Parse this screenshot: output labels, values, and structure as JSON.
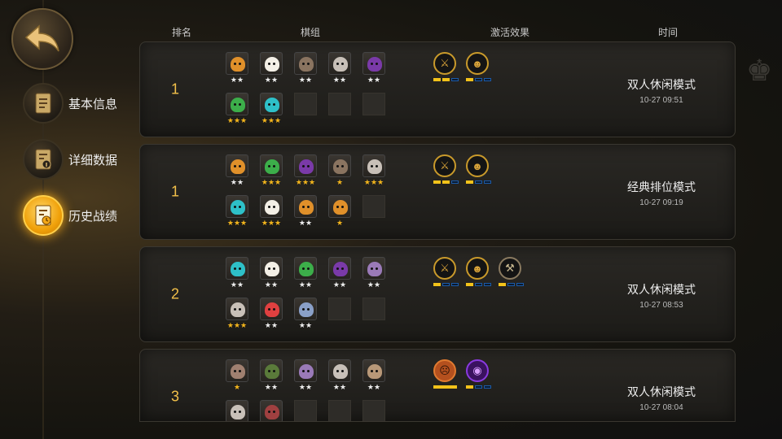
{
  "headers": {
    "rank": "排名",
    "lineup": "棋组",
    "traits": "激活效果",
    "time": "时间"
  },
  "menu": [
    {
      "label": "基本信息",
      "icon": "scroll-icon",
      "active": false
    },
    {
      "label": "详细数据",
      "icon": "info-document-icon",
      "active": false
    },
    {
      "label": "历史战绩",
      "icon": "clock-document-icon",
      "active": true
    }
  ],
  "records": [
    {
      "rank": "1",
      "mode": "双人休闲模式",
      "time": "10-27 09:51",
      "units": [
        {
          "color": "#e0902a",
          "stars": "★★",
          "gold": false
        },
        {
          "color": "#f3efe6",
          "stars": "★★",
          "gold": false
        },
        {
          "color": "#8a7460",
          "stars": "★★",
          "gold": false
        },
        {
          "color": "#c8c0b8",
          "stars": "★★",
          "gold": false
        },
        {
          "color": "#7a3aa8",
          "stars": "★★",
          "gold": false
        },
        {
          "color": "#3cae4a",
          "stars": "★★★",
          "gold": true
        },
        {
          "color": "#2ec0c8",
          "stars": "★★★",
          "gold": true
        },
        null,
        null,
        null
      ],
      "traits": [
        {
          "icon": "spears-icon",
          "glyph": "⚔",
          "pips": [
            1,
            1,
            0
          ]
        },
        {
          "icon": "goblin-icon",
          "glyph": "☻",
          "pips": [
            1,
            0,
            0
          ]
        }
      ]
    },
    {
      "rank": "1",
      "mode": "经典排位模式",
      "time": "10-27 09:19",
      "units": [
        {
          "color": "#e0902a",
          "stars": "★★",
          "gold": false
        },
        {
          "color": "#3cae4a",
          "stars": "★★★",
          "gold": true
        },
        {
          "color": "#7a3aa8",
          "stars": "★★★",
          "gold": true
        },
        {
          "color": "#8a7460",
          "stars": "★",
          "gold": true
        },
        {
          "color": "#c8c0b8",
          "stars": "★★★",
          "gold": true
        },
        {
          "color": "#2ec0c8",
          "stars": "★★★",
          "gold": true
        },
        {
          "color": "#f3efe6",
          "stars": "★★★",
          "gold": true
        },
        {
          "color": "#e0902a",
          "stars": "★★",
          "gold": false
        },
        {
          "color": "#e0902a",
          "stars": "★",
          "gold": true
        },
        null
      ],
      "traits": [
        {
          "icon": "spears-icon",
          "glyph": "⚔",
          "pips": [
            1,
            1,
            0
          ]
        },
        {
          "icon": "goblin-icon",
          "glyph": "☻",
          "pips": [
            1,
            0,
            0
          ]
        }
      ]
    },
    {
      "rank": "2",
      "mode": "双人休闲模式",
      "time": "10-27 08:53",
      "units": [
        {
          "color": "#2ec0c8",
          "stars": "★★",
          "gold": false
        },
        {
          "color": "#f3efe6",
          "stars": "★★",
          "gold": false
        },
        {
          "color": "#3cae4a",
          "stars": "★★",
          "gold": false
        },
        {
          "color": "#7a3aa8",
          "stars": "★★",
          "gold": false
        },
        {
          "color": "#9a7ab8",
          "stars": "★★",
          "gold": false
        },
        {
          "color": "#c8c0b8",
          "stars": "★★★",
          "gold": true
        },
        {
          "color": "#e04040",
          "stars": "★★",
          "gold": false
        },
        {
          "color": "#8aa0c8",
          "stars": "★★",
          "gold": false
        },
        null,
        null
      ],
      "traits": [
        {
          "icon": "spears-icon",
          "glyph": "⚔",
          "pips": [
            1,
            0,
            0
          ]
        },
        {
          "icon": "goblin-icon",
          "glyph": "☻",
          "pips": [
            1,
            0,
            0
          ]
        },
        {
          "icon": "axe-icon",
          "glyph": "⚒",
          "pips": [
            1,
            0,
            0
          ]
        }
      ]
    },
    {
      "rank": "3",
      "mode": "双人休闲模式",
      "time": "10-27 08:04",
      "units": [
        {
          "color": "#a08070",
          "stars": "★",
          "gold": true
        },
        {
          "color": "#5a7a3a",
          "stars": "★★",
          "gold": false
        },
        {
          "color": "#9a7ab8",
          "stars": "★★",
          "gold": false
        },
        {
          "color": "#c8c0b8",
          "stars": "★★",
          "gold": false
        },
        {
          "color": "#b89878",
          "stars": "★★",
          "gold": false
        },
        {
          "color": "#c8c0b8",
          "stars": "",
          "gold": false
        },
        {
          "color": "#a04040",
          "stars": "",
          "gold": false
        },
        null,
        null,
        null
      ],
      "traits": [
        {
          "icon": "demon-icon",
          "glyph": "☹",
          "pips": [
            2
          ],
          "style": "wide"
        },
        {
          "icon": "void-icon",
          "glyph": "◉",
          "pips": [
            1,
            0,
            0
          ],
          "style": "purple"
        }
      ]
    }
  ]
}
